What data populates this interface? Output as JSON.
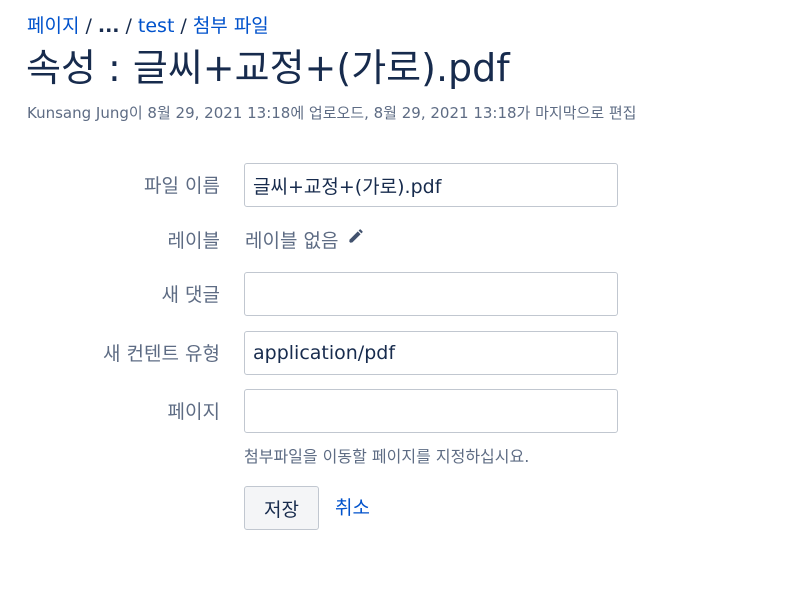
{
  "breadcrumb": {
    "items": [
      {
        "label": "페이지"
      },
      {
        "label": "..."
      },
      {
        "label": "test"
      },
      {
        "label": "첨부 파일"
      }
    ],
    "separator": "/"
  },
  "page": {
    "title": "속성 : 글씨+교정+(가로).pdf",
    "meta": "Kunsang Jung이 8월 29, 2021 13:18에 업로오드, 8월 29, 2021 13:18가 마지막으로 편집"
  },
  "form": {
    "filename_label": "파일 이름",
    "filename_value": "글씨+교정+(가로).pdf",
    "labels_label": "레이블",
    "labels_value": "레이블 없음",
    "comment_label": "새 댓글",
    "comment_value": "",
    "content_type_label": "새 컨텐트 유형",
    "content_type_value": "application/pdf",
    "page_label": "페이지",
    "page_value": "",
    "page_hint": "첨부파일을 이동할 페이지를 지정하십시요.",
    "save_label": "저장",
    "cancel_label": "취소"
  },
  "colors": {
    "link": "#0052cc",
    "text": "#172b4d",
    "muted": "#5e6c84",
    "border": "#c1c7d0"
  },
  "icons": {
    "edit_labels": "pencil-icon"
  }
}
